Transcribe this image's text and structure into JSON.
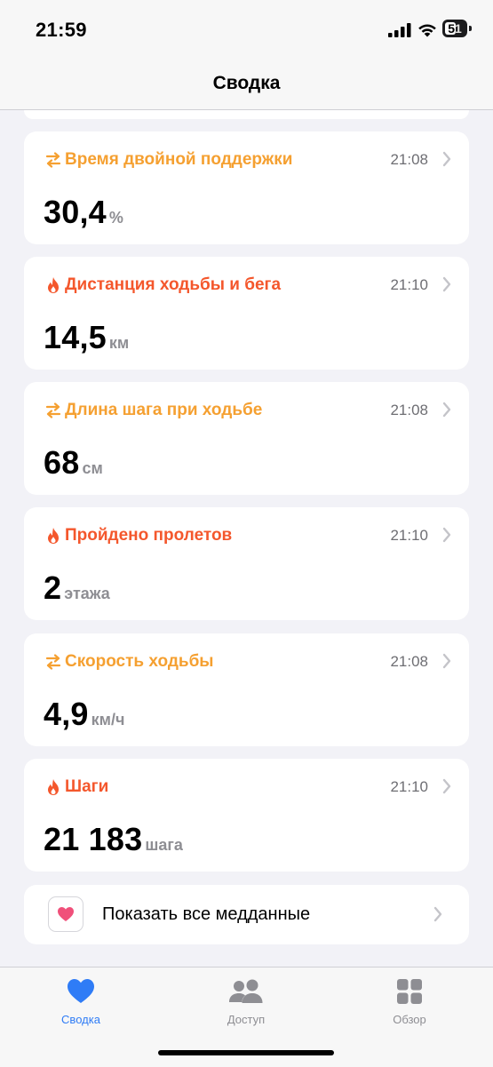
{
  "status_bar": {
    "time": "21:59",
    "battery": "51"
  },
  "nav": {
    "title": "Сводка"
  },
  "cards": [
    {
      "title": "Время двойной поддержки",
      "time": "21:08",
      "value": "30,4",
      "unit": "%",
      "icon": "arrows-swap-icon",
      "color": "#f5a031"
    },
    {
      "title": "Дистанция ходьбы и бега",
      "time": "21:10",
      "value": "14,5",
      "unit": "км",
      "icon": "flame-icon",
      "color": "#f4572c"
    },
    {
      "title": "Длина шага при ходьбе",
      "time": "21:08",
      "value": "68",
      "unit": "см",
      "icon": "arrows-swap-icon",
      "color": "#f5a031"
    },
    {
      "title": "Пройдено пролетов",
      "time": "21:10",
      "value": "2",
      "unit": "этажа",
      "icon": "flame-icon",
      "color": "#f4572c"
    },
    {
      "title": "Скорость ходьбы",
      "time": "21:08",
      "value": "4,9",
      "unit": "км/ч",
      "icon": "arrows-swap-icon",
      "color": "#f5a031"
    },
    {
      "title": "Шаги",
      "time": "21:10",
      "value": "21 183",
      "unit": "шага",
      "icon": "flame-icon",
      "color": "#f4572c"
    }
  ],
  "show_all": {
    "label": "Показать все медданные",
    "icon": "heart-icon"
  },
  "tabs": [
    {
      "label": "Сводка",
      "icon": "heart-icon",
      "active": true
    },
    {
      "label": "Доступ",
      "icon": "people-icon",
      "active": false
    },
    {
      "label": "Обзор",
      "icon": "grid-icon",
      "active": false
    }
  ],
  "colors": {
    "accent_blue": "#2f7cf6",
    "mobility_orange": "#f5a031",
    "activity_red": "#f4572c",
    "background": "#f2f2f7"
  }
}
